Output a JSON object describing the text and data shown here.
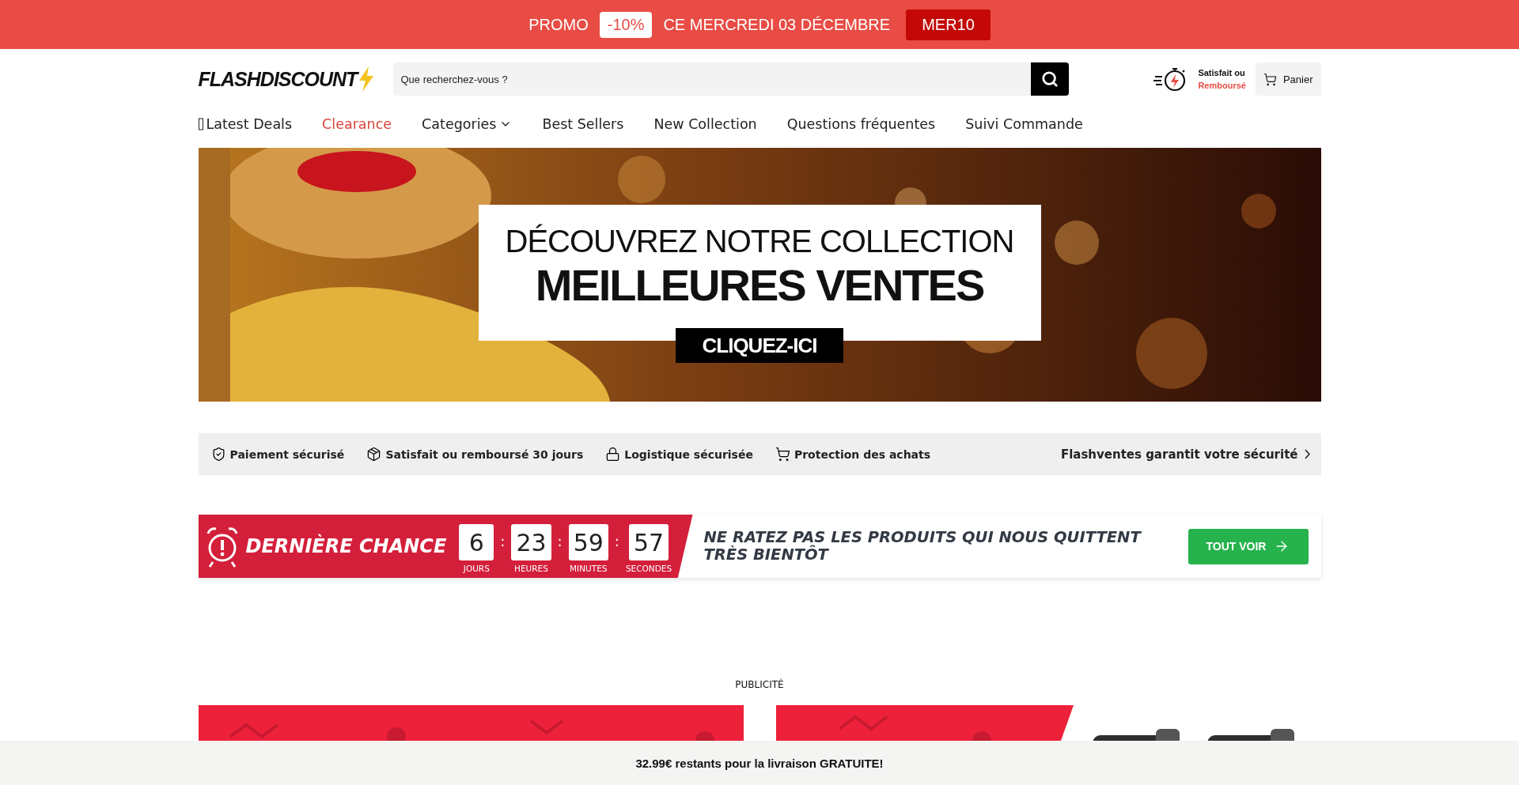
{
  "promo": {
    "label": "PROMO",
    "discount": "-10%",
    "text": "CE MERCREDI 03 DÉCEMBRE",
    "code": "MER10"
  },
  "header": {
    "logo": "FLASHDISCOUNT",
    "search": {
      "placeholder": "Que recherchez-vous ?"
    },
    "guarantee": [
      "Satisfait ou",
      "Remboursé"
    ],
    "cart": "Panier"
  },
  "nav": [
    {
      "label": "Latest Deals",
      "kind": "glyph",
      "highlight": false
    },
    {
      "label": "Clearance",
      "kind": "plain",
      "highlight": true
    },
    {
      "label": "Categories",
      "kind": "dropdown",
      "highlight": false
    },
    {
      "label": "Best Sellers",
      "kind": "plain",
      "highlight": false
    },
    {
      "label": "New Collection",
      "kind": "plain",
      "highlight": false
    },
    {
      "label": "Questions fréquentes",
      "kind": "plain",
      "highlight": false
    },
    {
      "label": "Suivi Commande",
      "kind": "plain",
      "highlight": false
    }
  ],
  "hero": {
    "line_1": "DÉCOUVREZ NOTRE COLLECTION",
    "line_2": "MEILLEURES VENTES",
    "button": "CLIQUEZ-ICI"
  },
  "trust": {
    "items": [
      "Paiement sécurisé",
      "Satisfait ou remboursé 30 jours",
      "Logistique sécurisée",
      "Protection des achats"
    ],
    "link": "Flashventes garantit votre sécurité"
  },
  "countdown": {
    "title": "DERNIÈRE CHANCE",
    "units": [
      {
        "value": "6",
        "label": "JOURS"
      },
      {
        "value": "23",
        "label": "HEURES"
      },
      {
        "value": "59",
        "label": "MINUTES"
      },
      {
        "value": "57",
        "label": "SECONDES"
      }
    ],
    "separator": ":",
    "message": "NE RATEZ PAS LES PRODUITS QUI NOUS QUITTENT TRÈS BIENTÔT",
    "button": "TOUT VOIR"
  },
  "ad_label": "PUBLICITÉ",
  "shipping_bar": "32.99€ restants pour la livraison GRATUITE!"
}
